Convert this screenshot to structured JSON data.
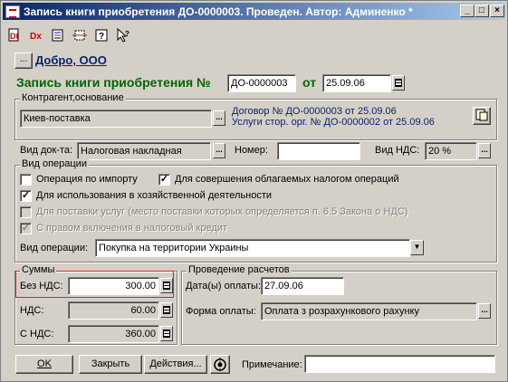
{
  "window": {
    "title": "Запись книги приобретения ДО-0000003. Проведен. Автор: Админенко *",
    "minimize": "_",
    "maximize": "□",
    "close": "×"
  },
  "toolbar": {
    "items": [
      "delete-doc-icon",
      "delete-mark-icon",
      "post-doc-icon",
      "move-doc-icon",
      "help-icon",
      "context-help-icon"
    ]
  },
  "header": {
    "firm_button": "...",
    "firm_name": "Добро, ООО",
    "doc_title": "Запись книги приобретения №",
    "doc_number": "ДО-0000003",
    "date_label": "от",
    "doc_date": "25.09.06"
  },
  "contractor_group": {
    "title": "Контрагент,основание",
    "contractor": "Киев-поставка",
    "basis_line1": "Договор № ДО-0000003 от 25.09.06",
    "basis_line2": "Услуги стор. орг. № ДО-0000002 от 25.09.06"
  },
  "doc_type": {
    "label": "Вид док-та:",
    "value": "Налоговая накладная",
    "number_label": "Номер:",
    "number_value": "",
    "vat_label": "Вид НДС:",
    "vat_value": "20 %"
  },
  "operation_group": {
    "title": "Вид операции",
    "import_label": "Операция по импорту",
    "taxable_label": "Для совершения облагаемых налогом операций",
    "business_label": "Для использования в хозяйственной деятельности",
    "services_label": "Для поставки услуг (место поставки которых определяется п. 6.5 Закона о НДС)",
    "credit_label": "С правом включения в налоговый кредит",
    "operation_type_label": "Вид операции:",
    "operation_type_value": "Покупка на территории Украины"
  },
  "sums_group": {
    "title": "Суммы",
    "no_vat_label": "Без НДС:",
    "no_vat_value": "300.00",
    "vat_label": "НДС:",
    "vat_value": "60.00",
    "with_vat_label": "С НДС:",
    "with_vat_value": "360.00"
  },
  "payment_group": {
    "title": "Проведение расчетов",
    "date_label": "Дата(ы) оплаты:",
    "date_value": "27.09.06",
    "form_label": "Форма оплаты:",
    "form_value": "Оплата з розрахункового рахунку"
  },
  "footer": {
    "ok": "OK",
    "close": "Закрыть",
    "actions": "Действия...",
    "note_label": "Примечание:",
    "note_value": ""
  }
}
